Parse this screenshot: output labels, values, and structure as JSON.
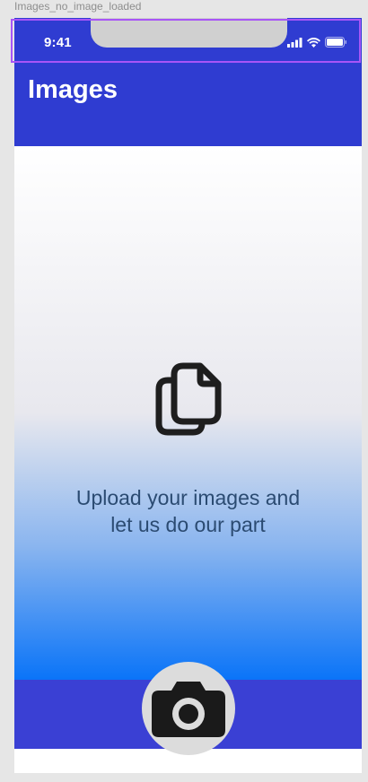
{
  "frame": {
    "label": "Images_no_image_loaded"
  },
  "status_bar": {
    "time": "9:41",
    "icons": [
      "signal-icon",
      "wifi-icon",
      "battery-icon"
    ]
  },
  "header": {
    "title": "Images"
  },
  "main": {
    "icon": "documents-icon",
    "message_line1": "Upload your images and",
    "message_line2": "let us do our part"
  },
  "bottom_bar": {
    "action_icon": "camera-icon"
  },
  "colors": {
    "header_bg": "#2f3cd1",
    "bottom_bar_bg": "#3a40d4",
    "text": "#2b4b72",
    "gradient_end": "#0a74f8",
    "selection": "#a855f7"
  }
}
